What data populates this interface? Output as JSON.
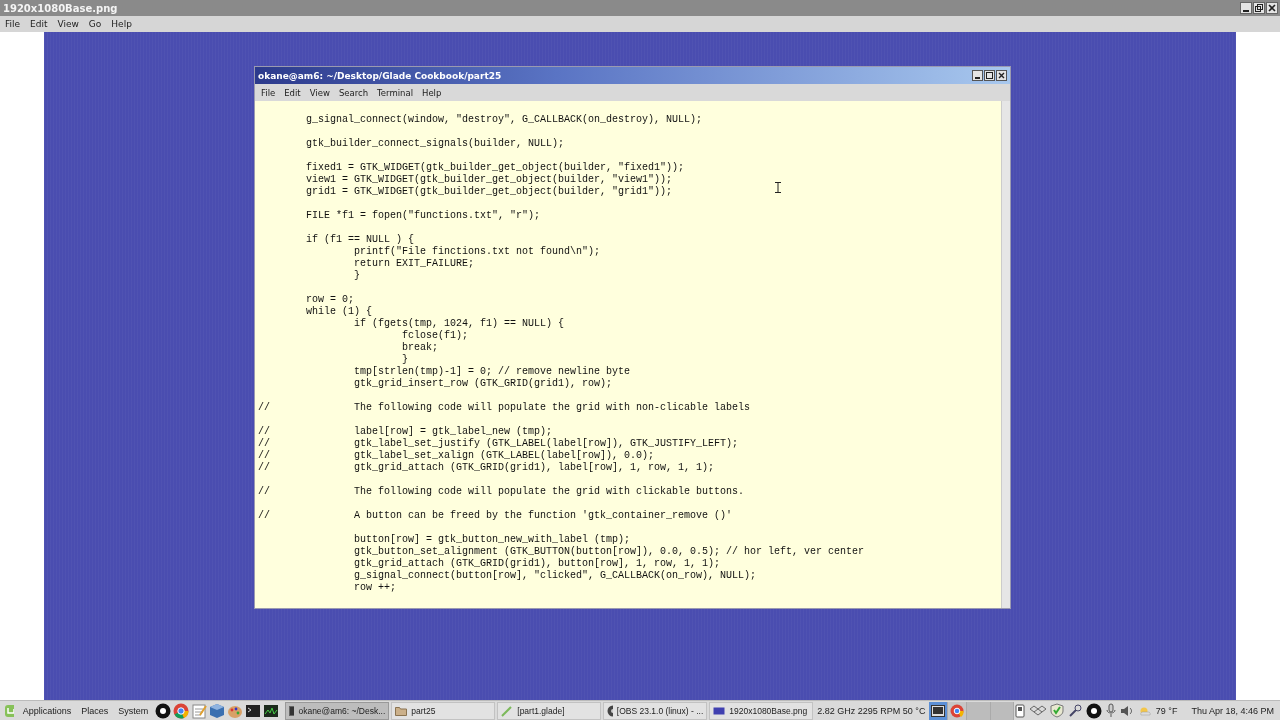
{
  "viewer": {
    "title": "1920x1080Base.png",
    "menu": [
      "File",
      "Edit",
      "View",
      "Go",
      "Help"
    ]
  },
  "terminal": {
    "title": "okane@am6: ~/Desktop/Glade Cookbook/part25",
    "menu": [
      "File",
      "Edit",
      "View",
      "Search",
      "Terminal",
      "Help"
    ],
    "code_blocks": [
      "        g_signal_connect(window, \"destroy\", G_CALLBACK(on_destroy), NULL);\n\n        gtk_builder_connect_signals(builder, NULL);\n\n        fixed1 = GTK_WIDGET(gtk_builder_get_object(builder, \"fixed1\"));\n        view1 = GTK_WIDGET(gtk_builder_get_object(builder, \"view1\"));\n        grid1 = GTK_WIDGET(gtk_builder_get_object(builder, \"grid1\"));\n\n        FILE *f1 = fopen(\"functions.txt\", \"r\");\n\n        if (f1 == NULL ) {\n                printf(\"File finctions.txt not found\\n\");\n                return EXIT_FAILURE;\n                }\n\n        row = 0;\n        while (1) {\n                if (fgets(tmp, 1024, f1) == NULL) {\n                        fclose(f1);\n                        break;\n                        }\n                tmp[strlen(tmp)-1] = 0; // remove newline byte\n                gtk_grid_insert_row (GTK_GRID(grid1), row);\n\n//              The following code will populate the grid with non-clicable labels\n\n//              label[row] = gtk_label_new (tmp);\n//              gtk_label_set_justify (GTK_LABEL(label[row]), GTK_JUSTIFY_LEFT);\n//              gtk_label_set_xalign (GTK_LABEL(label[row]), 0.0);\n//              gtk_grid_attach (GTK_GRID(grid1), label[row], 1, row, 1, 1);\n\n//              The following code will populate the grid with clickable buttons.\n\n//              A button can be freed by the function 'gtk_container_remove ()'",
      "                button[row] = gtk_button_new_with_label (tmp);\n                gtk_button_set_alignment (GTK_BUTTON(button[row]), 0.0, 0.5); // hor left, ver center\n                gtk_grid_attach (GTK_GRID(grid1), button[row], 1, row, 1, 1);\n                g_signal_connect(button[row], \"clicked\", G_CALLBACK(on_row), NULL);\n                row ++;"
    ]
  },
  "taskbar": {
    "menu": [
      "Applications",
      "Places",
      "System"
    ],
    "tasks": [
      {
        "kind": "terminal",
        "label": "okane@am6: ~/Desk...",
        "selected": true
      },
      {
        "kind": "folder",
        "label": "part25",
        "selected": false
      },
      {
        "kind": "glade",
        "label": "[part1.glade]",
        "selected": false
      },
      {
        "kind": "obs",
        "label": "[OBS 23.1.0 (linux) - ...",
        "selected": false
      },
      {
        "kind": "image",
        "label": "1920x1080Base.png",
        "selected": false
      }
    ],
    "cpu_monitor": "2.82 GHz 2295 RPM 50 °C",
    "weather": "79 °F",
    "clock": "Thu Apr 18,  4:46 PM"
  }
}
